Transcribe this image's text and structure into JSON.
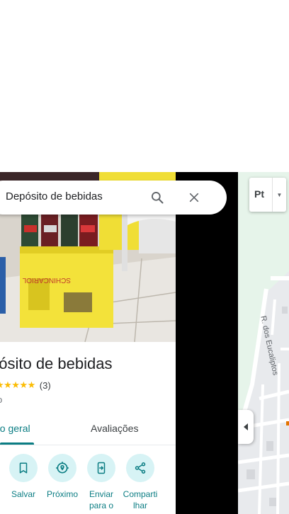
{
  "search": {
    "query": "Depósito de bebidas"
  },
  "place": {
    "title": "pósito de bebidas",
    "stars": "★★★★★",
    "rating": 5,
    "review_count": "(3)",
    "category": "o"
  },
  "tabs": [
    {
      "label": "ão geral",
      "active": true
    },
    {
      "label": "Avaliações",
      "active": false
    }
  ],
  "actions": [
    {
      "label": "Salvar",
      "icon": "bookmark-icon"
    },
    {
      "label": "Próximo",
      "icon": "nearby-icon"
    },
    {
      "label": "Enviar para o",
      "icon": "send-to-phone-icon"
    },
    {
      "label": "Compartilhar",
      "icon": "share-icon"
    }
  ],
  "action_labels": {
    "save": "Salvar",
    "nearby": "Próximo",
    "send_line1": "Enviar",
    "send_line2": "para o",
    "share_line1": "Comparti",
    "share_line2": "lhar"
  },
  "map": {
    "layer_button": "Pt",
    "street_name": "R. dos Eucaliptos"
  },
  "colors": {
    "accent": "#0b7d83",
    "action_circle": "#d7f3f5",
    "star": "#fbbc04",
    "map_green": "#e6f4ea"
  }
}
